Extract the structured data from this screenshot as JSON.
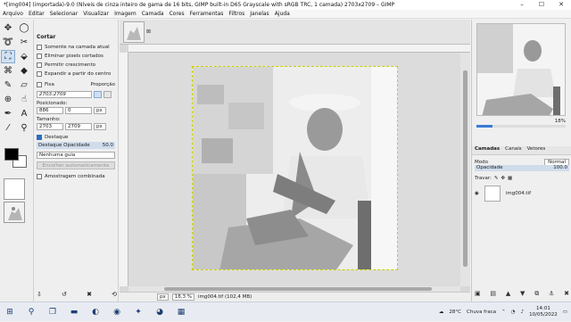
{
  "window": {
    "title": "*[img004] (importada)-9.0 (Níveis de cinza inteiro de gama de 16 bits, GIMP built-in D65 Grayscale with sRGB TRC, 1 camada) 2703x2709 – GIMP",
    "min": "–",
    "max": "☐",
    "close": "✕"
  },
  "menu": [
    "Arquivo",
    "Editar",
    "Selecionar",
    "Visualizar",
    "Imagem",
    "Camada",
    "Cores",
    "Ferramentas",
    "Filtros",
    "Janelas",
    "Ajuda"
  ],
  "tool_options": {
    "title": "Cortar",
    "options": [
      {
        "label": "Somente na camada atual",
        "checked": false
      },
      {
        "label": "Eliminar pixels cortados",
        "checked": false
      },
      {
        "label": "Permitir crescimento",
        "checked": false
      },
      {
        "label": "Expandir a partir do centro",
        "checked": false
      }
    ],
    "fixed_label": "Fixa",
    "fixed_mode": "Proporção",
    "ratio": "2703:2709",
    "position_label": "Posicionado:",
    "pos_x": "886",
    "pos_y": "0",
    "pos_unit": "px",
    "size_label": "Tamanho:",
    "size_w": "2703",
    "size_h": "2709",
    "size_unit": "px",
    "highlight_label": "Destaque",
    "highlight_opacity_label": "Destaque Opacidade",
    "highlight_opacity_value": "50.0",
    "guide": "Nenhuma guia",
    "shrink_button": "Encolher automaticamente",
    "combined_label": "Amostragem combinada"
  },
  "canvas": {
    "tab_close": "⊠",
    "status_unit": "px",
    "status_zoom": "18,3 %",
    "status_info": "img004.tif (102,4 MB)"
  },
  "right_dock": {
    "zoom_value": "18%",
    "zoom_fraction": 0.18,
    "tabs": [
      "Camadas",
      "Canais",
      "Vetores"
    ],
    "mode_label": "Modo",
    "mode_value": "Normal",
    "opacity_label": "Opacidade",
    "opacity_value": "100.0",
    "lock_label": "Travar:",
    "layer_name": "img004.tif"
  },
  "taskbar": {
    "weather_temp": "28°C",
    "weather_text": "Chuva fraca",
    "time": "14:01",
    "date": "10/05/2022"
  },
  "colors": {
    "accent": "#3a7bd5",
    "selection": "#c8d000"
  }
}
